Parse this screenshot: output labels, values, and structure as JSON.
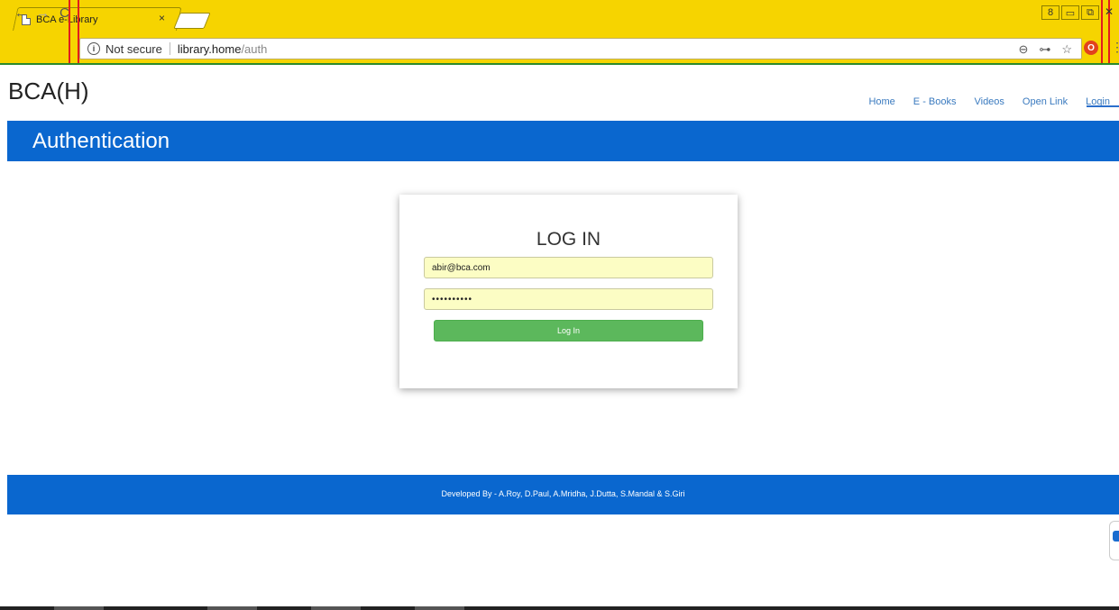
{
  "browser": {
    "tab_title": "BCA e-Library",
    "tab_close": "×",
    "security_label": "Not secure",
    "url_host": "library.home",
    "url_path": "/auth",
    "info_glyph": "i",
    "back_glyph": "←",
    "forward_glyph": "→",
    "reload_glyph": "C",
    "zoom_glyph": "⊖",
    "key_glyph": "⊶",
    "star_glyph": "☆",
    "ext_glyph": "O",
    "menu_glyph": "⋮",
    "win_user": "8",
    "win_min": "▭",
    "win_restore": "⧉",
    "win_close": "✕",
    "accent": "#f6d400"
  },
  "header": {
    "brand": "BCA(H)",
    "nav": [
      {
        "label": "Home"
      },
      {
        "label": "E - Books"
      },
      {
        "label": "Videos"
      },
      {
        "label": "Open Link"
      },
      {
        "label": "Login"
      }
    ],
    "active_nav": "Login"
  },
  "page": {
    "title": "Authentication",
    "band_color": "#0a67cf"
  },
  "login": {
    "heading": "LOG IN",
    "email_value": "abir@bca.com",
    "password_value": "••••••••••",
    "button_label": "Log In",
    "button_color": "#5cb85c"
  },
  "footer": {
    "credits": "Developed By - A.Roy, D.Paul, A.Mridha, J.Dutta, S.Mandal & S.Giri"
  }
}
